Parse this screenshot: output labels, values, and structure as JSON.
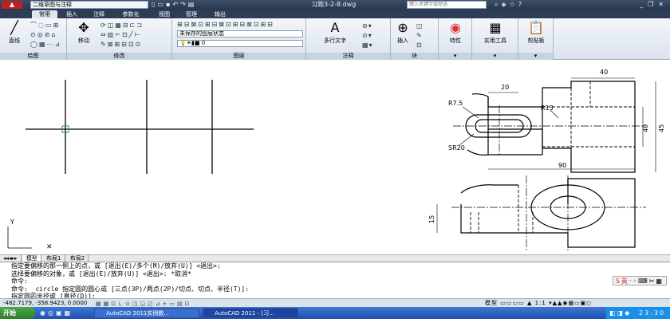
{
  "titlebar": {
    "workspace": "二维草图与注释",
    "document": "习题3-2-8.dwg",
    "search_placeholder": "键入关键字或短语"
  },
  "tabs": [
    "常用",
    "插入",
    "注释",
    "参数化",
    "视图",
    "管理",
    "输出"
  ],
  "ribbon": {
    "draw": {
      "label": "绘图",
      "line": "直线"
    },
    "modify": {
      "label": "修改",
      "move": "移动"
    },
    "layers": {
      "label": "图层",
      "state": "未保存的图层状态",
      "current": "0"
    },
    "annotation": {
      "label": "注释",
      "mtext": "多行文字"
    },
    "block": {
      "label": "块",
      "insert": "插入"
    },
    "properties": {
      "label": "特性"
    },
    "utilities": {
      "label": "实用工具"
    },
    "clipboard": {
      "label": "剪贴板"
    }
  },
  "drawing": {
    "dims": {
      "d40": "40",
      "d20": "20",
      "r75": "R7.5",
      "r13": "R13",
      "sr20": "SR20",
      "d90": "90",
      "d40v": "40",
      "d45": "45",
      "d15": "15"
    }
  },
  "layout_tabs": [
    "模型",
    "布局1",
    "布局2"
  ],
  "command_lines": [
    "指定要偏移的那一侧上的点，或 [退出(E)/多个(M)/放弃(U)] <退出>:",
    "选择要偏移的对象，或 [退出(E)/放弃(U)] <退出>:  *取消*",
    "命令:",
    "命令: _circle 指定圆的圆心或 [三点(3P)/两点(2P)/切点、切点、半径(T)]:",
    "指定圆的半径或 [直径(D)]:"
  ],
  "ime": "英",
  "status": {
    "coords": "-482.7179, -358.9423, 0.0000",
    "model": "模型",
    "scale": "1:1"
  },
  "taskbar": {
    "start": "开始",
    "task1": "AutoCAD 2011实例教...",
    "task2": "AutoCAD 2011 - [习...",
    "time": "23:30"
  }
}
